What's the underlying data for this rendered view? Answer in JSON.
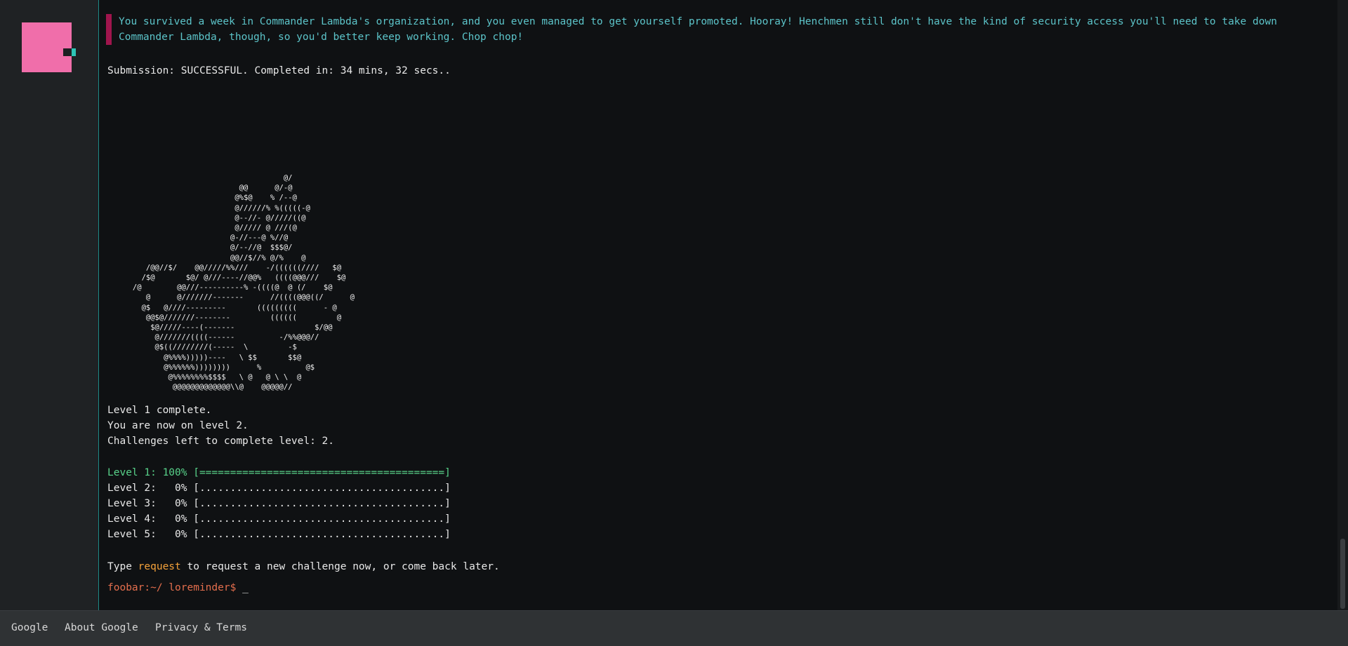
{
  "quote_text": "You survived a week in Commander Lambda's organization, and you even managed to get yourself promoted. Hooray! Henchmen still don't have the kind of security access you'll need to take down Commander Lambda, though, so you'd better keep working. Chop chop!",
  "submission": "Submission: SUCCESSFUL. Completed in: 34 mins, 32 secs..",
  "ascii_art": "                                        @/\n                              @@      @/-@\n                             @%$@    % /--@\n                             @//////% %(((((-@\n                             @--//- @/////((@\n                             @///// @ ///(@\n                            @-//---@ %//@\n                            @/--//@  $$$@/\n                            @@//$//% @/%    @\n         /@@//$/    @@/////%%///    -/((((((////   $@\n        /$@       $@/ @///----//@@%   ((((@@@///    $@\n      /@        @@///----------% -((((@  @ (/    $@\n         @      @///////-------      //((((@@@((/      @\n        @$   @////---------       (((((((((      - @\n         @@$@///////--------         ((((((         @\n          $@/////----(-------                  $/@@\n           @///////((((------          -/%%@@@//\n           @$((////////(-----  \\         -$\n             @%%%%)))))----   \\ $$       $$@\n             @%%%%%%))))))))      %          @$\n              @%%%%%%%%$$$$   \\ @   @ \\ \\  @\n               @@@@@@@@@@@@@\\\\@    @@@@@//",
  "level_complete": "Level 1 complete.",
  "now_on_level": "You are now on level 2.",
  "challenges_left": "Challenges left to complete level: 2.",
  "levels": [
    {
      "label": "Level 1: 100% [========================================]",
      "percent": 100
    },
    {
      "label": "Level 2:   0% [........................................]",
      "percent": 0
    },
    {
      "label": "Level 3:   0% [........................................]",
      "percent": 0
    },
    {
      "label": "Level 4:   0% [........................................]",
      "percent": 0
    },
    {
      "label": "Level 5:   0% [........................................]",
      "percent": 0
    }
  ],
  "type_hint": {
    "before": "Type ",
    "command": "request",
    "after": " to request a new challenge now, or come back later."
  },
  "prompt": {
    "text": "foobar:~/ loreminder$ ",
    "cursor": "_"
  },
  "footer": {
    "google": "Google",
    "about": "About Google",
    "privacy": "Privacy & Terms"
  },
  "colors": {
    "quote_bar": "#a0154d",
    "quote_text": "#5cc4c9",
    "level_complete": "#58d38a",
    "command": "#f3a13a",
    "prompt": "#e46e4d",
    "avatar": "#f06eaa"
  }
}
